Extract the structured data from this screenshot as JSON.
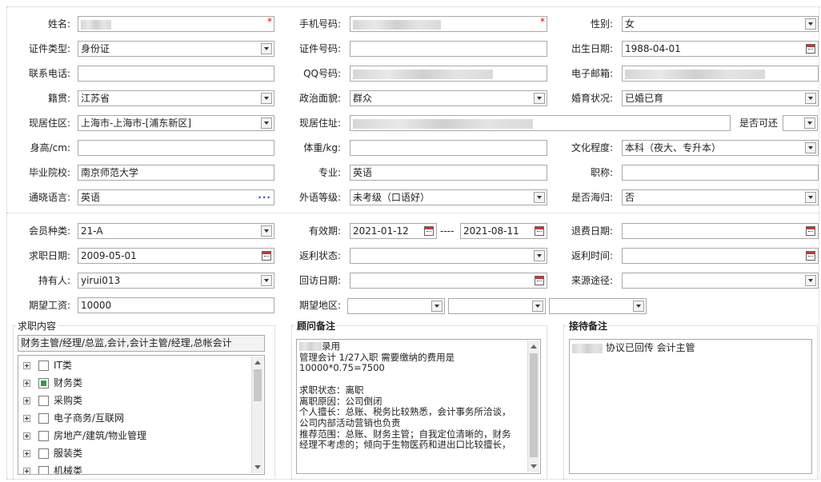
{
  "required_mark": "*",
  "personal": {
    "name": {
      "label": "姓名:",
      "value": ""
    },
    "mobile": {
      "label": "手机号码:",
      "value": ""
    },
    "gender": {
      "label": "性别:",
      "value": "女"
    },
    "id_type": {
      "label": "证件类型:",
      "value": "身份证"
    },
    "id_number": {
      "label": "证件号码:",
      "value": ""
    },
    "birthday": {
      "label": "出生日期:",
      "value": "1988-04-01"
    },
    "phone": {
      "label": "联系电话:",
      "value": ""
    },
    "qq": {
      "label": "QQ号码:",
      "value": ""
    },
    "email": {
      "label": "电子邮箱:",
      "value": ""
    },
    "native_place": {
      "label": "籍贯:",
      "value": "江苏省"
    },
    "politics": {
      "label": "政治面貌:",
      "value": "群众"
    },
    "marital": {
      "label": "婚育状况:",
      "value": "已婚已育"
    },
    "residence_area": {
      "label": "现居住区:",
      "value": "上海市-上海市-[浦东新区]"
    },
    "address": {
      "label": "现居住址:",
      "value": ""
    },
    "available": {
      "label": "是否可还",
      "value": ""
    },
    "height": {
      "label": "身高/cm:",
      "value": ""
    },
    "weight": {
      "label": "体重/kg:",
      "value": ""
    },
    "education": {
      "label": "文化程度:",
      "value": "本科（夜大、专升本）"
    },
    "school": {
      "label": "毕业院校:",
      "value": "南京师范大学"
    },
    "major": {
      "label": "专业:",
      "value": "英语"
    },
    "title": {
      "label": "职称:",
      "value": ""
    },
    "language": {
      "label": "通晓语言:",
      "value": "英语",
      "more": "···"
    },
    "language_level": {
      "label": "外语等级:",
      "value": "未考级（口语好）"
    },
    "overseas": {
      "label": "是否海归:",
      "value": "否"
    }
  },
  "membership": {
    "member_type": {
      "label": "会员种类:",
      "value": "21-A"
    },
    "valid_period": {
      "label": "有效期:",
      "start": "2021-01-12",
      "sep": "----",
      "end": "2021-08-11"
    },
    "refund_date": {
      "label": "退费日期:",
      "value": ""
    },
    "job_date": {
      "label": "求职日期:",
      "value": "2009-05-01"
    },
    "rebate_status": {
      "label": "返利状态:",
      "value": ""
    },
    "rebate_time": {
      "label": "返利时间:",
      "value": ""
    },
    "holder": {
      "label": "持有人:",
      "value": "yirui013"
    },
    "visit_date": {
      "label": "回访日期:",
      "value": ""
    },
    "source": {
      "label": "来源途径:",
      "value": ""
    },
    "salary": {
      "label": "期望工资:",
      "value": "10000"
    },
    "region": {
      "label": "期望地区:",
      "values": [
        "",
        "",
        ""
      ]
    }
  },
  "job_content": {
    "title": "求职内容",
    "selected_text": "财务主管/经理/总监,会计,会计主管/经理,总帐会计",
    "categories": [
      {
        "label": "IT类",
        "checked": false
      },
      {
        "label": "财务类",
        "checked": true
      },
      {
        "label": "采购类",
        "checked": false
      },
      {
        "label": "电子商务/互联网",
        "checked": false
      },
      {
        "label": "房地产/建筑/物业管理",
        "checked": false
      },
      {
        "label": "服装类",
        "checked": false
      },
      {
        "label": "机械类",
        "checked": false
      }
    ]
  },
  "consultant_notes": {
    "title": "顾问备注",
    "lines": [
      "录用",
      "管理会计 1/27入职 需要缴纳的费用是",
      "10000*0.75=7500",
      "",
      "求职状态：离职",
      "离职原因：公司倒闭",
      "个人擅长：总账、税务比较熟悉，会计事务所洽谈，",
      "公司内部活动营销也负责",
      "推荐范围：总账、财务主管；自我定位清晰的，财务",
      "经理不考虑的；倾向于生物医药和进出口比较擅长，"
    ]
  },
  "reception_notes": {
    "title": "接待备注",
    "text": "协议已回传 会计主管"
  }
}
